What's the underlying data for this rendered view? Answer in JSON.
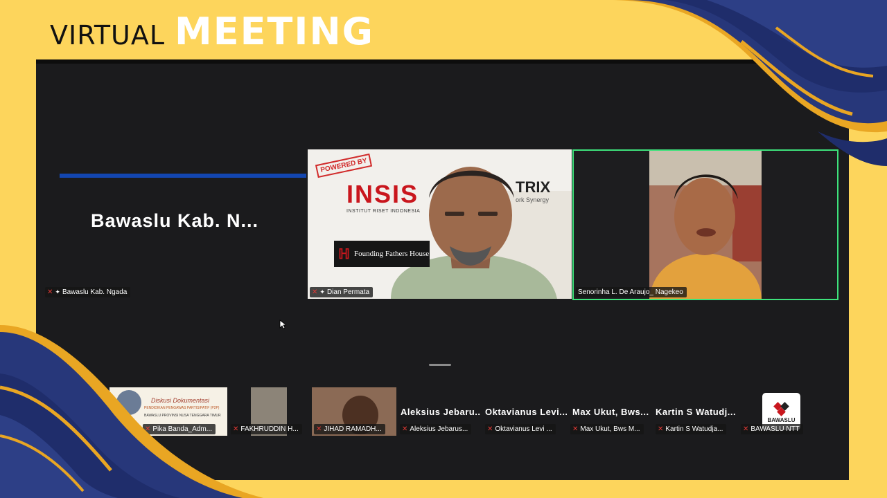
{
  "banner": {
    "virtual": "VIRTUAL",
    "meeting": "MEETING"
  },
  "colors": {
    "yellow": "#fdd55c",
    "navy": "#1f2d6b",
    "gold": "#e9a623",
    "active_speaker": "#3ee27b"
  },
  "gallery": [
    {
      "display_name": "Bawaslu Kab. N...",
      "tag": "Bawaslu Kab. Ngada",
      "muted": true
    },
    {
      "tag": "Dian Permata",
      "muted": true,
      "overlay": {
        "powered": "POWERED BY",
        "insis": "INSIS",
        "insis_sub": "INSTITUT RISET INDONESIA",
        "ffh": "Founding Fathers House",
        "trix": "TRIX",
        "trix_sub": "ork Synergy"
      }
    },
    {
      "tag": "Senorinha L. De Araujo_ Nagekeo",
      "muted": false,
      "active": true
    }
  ],
  "thumbs": [
    {
      "tag": "Pika Banda_Adm...",
      "muted": true,
      "slide": {
        "l1": "Diskusi Dokumentasi",
        "l2": "PENDIDIKAN PENGAWAS PARTISIPATIF (P2P)",
        "l3": "BAWASLU PROVINSI NUSA TENGGARA TIMUR"
      }
    },
    {
      "tag": "FAKHRUDDIN H...",
      "muted": true
    },
    {
      "tag": "JIHAD RAMADH...",
      "muted": true
    },
    {
      "name": "Aleksius Jebaru...",
      "tag": "Aleksius Jebarus...",
      "muted": true
    },
    {
      "name": "Oktavianus Levi...",
      "tag": "Oktavianus Levi ...",
      "muted": true
    },
    {
      "name": "Max Ukut, Bws...",
      "tag": "Max Ukut, Bws M...",
      "muted": true
    },
    {
      "name": "Kartin S Watudj...",
      "tag": "Kartin S Watudja...",
      "muted": true
    },
    {
      "tag": "BAWASLU NTT",
      "muted": true,
      "logo": "BAWASLU"
    }
  ]
}
